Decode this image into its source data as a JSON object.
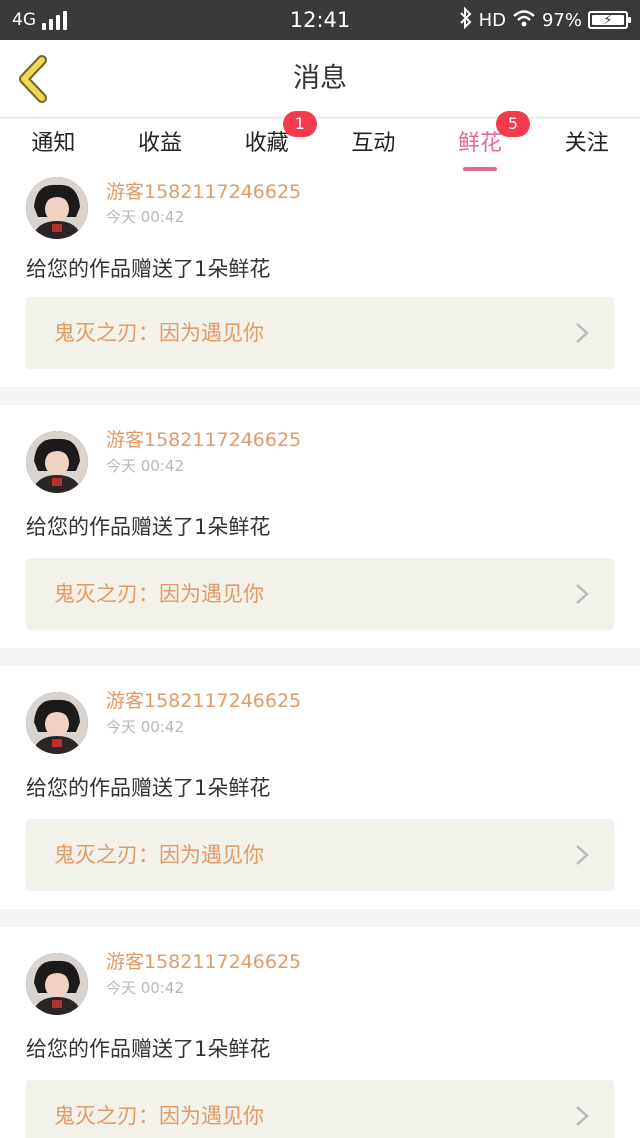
{
  "status_bar": {
    "network": "4G",
    "time": "12:41",
    "hd": "HD",
    "battery": "97%"
  },
  "header": {
    "title": "消息"
  },
  "tabs": [
    {
      "label": "通知",
      "badge": ""
    },
    {
      "label": "收益",
      "badge": ""
    },
    {
      "label": "收藏",
      "badge": "1"
    },
    {
      "label": "互动",
      "badge": ""
    },
    {
      "label": "鲜花",
      "badge": "5",
      "active": true
    },
    {
      "label": "关注",
      "badge": ""
    }
  ],
  "messages": [
    {
      "user": "游客1582117246625",
      "time": "今天 00:42",
      "text": "给您的作品赠送了1朵鲜花",
      "work": "鬼灭之刃：因为遇见你"
    },
    {
      "user": "游客1582117246625",
      "time": "今天 00:42",
      "text": "给您的作品赠送了1朵鲜花",
      "work": "鬼灭之刃：因为遇见你"
    },
    {
      "user": "游客1582117246625",
      "time": "今天 00:42",
      "text": "给您的作品赠送了1朵鲜花",
      "work": "鬼灭之刃：因为遇见你"
    },
    {
      "user": "游客1582117246625",
      "time": "今天 00:42",
      "text": "给您的作品赠送了1朵鲜花",
      "work": "鬼灭之刃：因为遇见你"
    }
  ],
  "colors": {
    "accent": "#e4679a",
    "username": "#e29a68",
    "badge": "#f43a4c",
    "back_arrow": "#f0d74e"
  }
}
